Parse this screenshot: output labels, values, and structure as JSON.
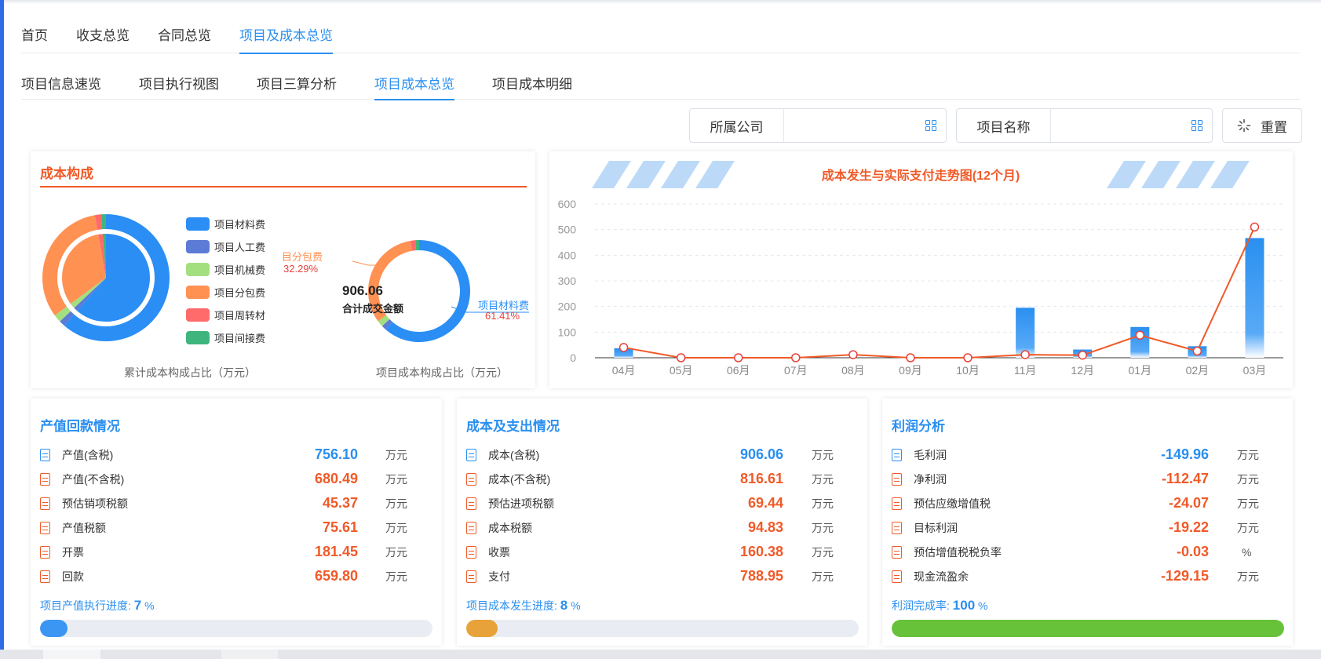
{
  "nav": {
    "main_tabs": [
      "首页",
      "收支总览",
      "合同总览",
      "项目及成本总览"
    ],
    "sub_tabs": [
      "项目信息速览",
      "项目执行视图",
      "项目三算分析",
      "项目成本总览",
      "项目成本明细"
    ]
  },
  "filters": {
    "company_label": "所属公司",
    "project_label": "项目名称",
    "reset_label": "重置"
  },
  "cost_composition": {
    "title": "成本构成",
    "legend": [
      {
        "label": "项目材料费",
        "color": "#2a8ef5"
      },
      {
        "label": "项目人工费",
        "color": "#5b7bd6"
      },
      {
        "label": "项目机械费",
        "color": "#a3df7f"
      },
      {
        "label": "项目分包费",
        "color": "#ff9152"
      },
      {
        "label": "项目周转材",
        "color": "#ff6b6b"
      },
      {
        "label": "项目间接费",
        "color": "#3db57c"
      }
    ],
    "pie1_caption": "累计成本构成占比（万元）",
    "pie2_caption": "项目成本构成占比（万元）",
    "donut_total": "906.06",
    "donut_total_label": "合计成交金额",
    "callout_left_name": "目分包费",
    "callout_left_pct": "32.29%",
    "callout_right_name": "项目材料费",
    "callout_right_pct": "61.41%"
  },
  "chart_data": {
    "type": "bar",
    "title": "成本发生与实际支付走势图(12个月)",
    "categories": [
      "04月",
      "05月",
      "06月",
      "07月",
      "08月",
      "09月",
      "10月",
      "11月",
      "12月",
      "01月",
      "02月",
      "03月"
    ],
    "ylim": [
      0,
      600
    ],
    "yticks": [
      0,
      100,
      200,
      300,
      400,
      500,
      600
    ],
    "series": [
      {
        "type": "bar",
        "values": [
          37,
          0,
          0,
          0,
          0,
          0,
          0,
          195,
          32,
          120,
          45,
          467
        ]
      },
      {
        "type": "line",
        "values": [
          40,
          0,
          0,
          0,
          12,
          0,
          0,
          12,
          10,
          88,
          26,
          510
        ]
      }
    ],
    "colors": {
      "bar": "#2a8ff0",
      "line": "#f05a28"
    }
  },
  "stats": {
    "output": {
      "title": "产值回款情况",
      "rows": [
        {
          "label": "产值(含税)",
          "value": "756.10",
          "unit": "万元",
          "color": "blue"
        },
        {
          "label": "产值(不含税)",
          "value": "680.49",
          "unit": "万元",
          "color": "orange"
        },
        {
          "label": "预估销项税额",
          "value": "45.37",
          "unit": "万元",
          "color": "orange"
        },
        {
          "label": "产值税额",
          "value": "75.61",
          "unit": "万元",
          "color": "orange"
        },
        {
          "label": "开票",
          "value": "181.45",
          "unit": "万元",
          "color": "orange"
        },
        {
          "label": "回款",
          "value": "659.80",
          "unit": "万元",
          "color": "orange"
        }
      ],
      "progress_label": "项目产值执行进度:",
      "progress_value": "7",
      "progress_unit": "%",
      "progress_fraction": 0.07,
      "progress_color": "#3a96f2"
    },
    "cost": {
      "title": "成本及支出情况",
      "rows": [
        {
          "label": "成本(含税)",
          "value": "906.06",
          "unit": "万元",
          "color": "blue"
        },
        {
          "label": "成本(不含税)",
          "value": "816.61",
          "unit": "万元",
          "color": "orange"
        },
        {
          "label": "预估进项税额",
          "value": "69.44",
          "unit": "万元",
          "color": "orange"
        },
        {
          "label": "成本税额",
          "value": "94.83",
          "unit": "万元",
          "color": "orange"
        },
        {
          "label": "收票",
          "value": "160.38",
          "unit": "万元",
          "color": "orange"
        },
        {
          "label": "支付",
          "value": "788.95",
          "unit": "万元",
          "color": "orange"
        }
      ],
      "progress_label": "项目成本发生进度:",
      "progress_value": "8",
      "progress_unit": "%",
      "progress_fraction": 0.08,
      "progress_color": "#e8a23a"
    },
    "profit": {
      "title": "利润分析",
      "rows": [
        {
          "label": "毛利润",
          "value": "-149.96",
          "unit": "万元",
          "color": "blue"
        },
        {
          "label": "净利润",
          "value": "-112.47",
          "unit": "万元",
          "color": "orange"
        },
        {
          "label": "预估应缴增值税",
          "value": "-24.07",
          "unit": "万元",
          "color": "orange"
        },
        {
          "label": "目标利润",
          "value": "-19.22",
          "unit": "万元",
          "color": "orange"
        },
        {
          "label": "预估增值税税负率",
          "value": "-0.03",
          "unit": "%",
          "color": "orange"
        },
        {
          "label": "现金流盈余",
          "value": "-129.15",
          "unit": "万元",
          "color": "orange"
        }
      ],
      "progress_label": "利润完成率:",
      "progress_value": "100",
      "progress_unit": "%",
      "progress_fraction": 1.0,
      "progress_color": "#67c23a"
    }
  }
}
